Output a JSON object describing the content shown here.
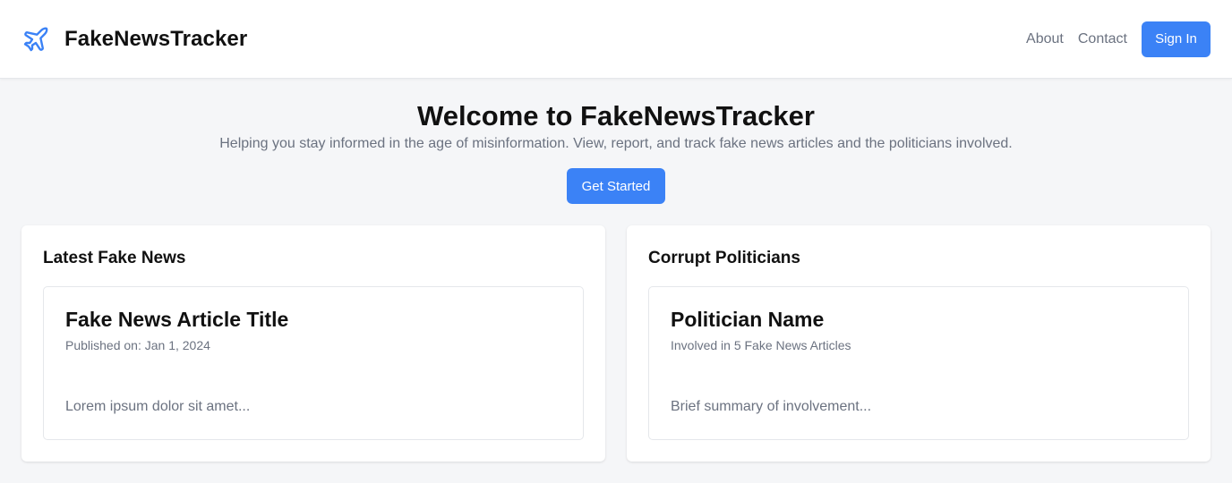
{
  "navbar": {
    "logo_icon": "airplane-icon",
    "brand": "FakeNewsTracker",
    "links": [
      "About",
      "Contact"
    ],
    "signin_label": "Sign In"
  },
  "hero": {
    "title": "Welcome to FakeNewsTracker",
    "subtitle": "Helping you stay informed in the age of misinformation. View, report, and track fake news articles and the politicians involved.",
    "cta_label": "Get Started"
  },
  "news": {
    "heading": "Latest Fake News",
    "article": {
      "title": "Fake News Article Title",
      "meta": "Published on: Jan 1, 2024",
      "excerpt": "Lorem ipsum dolor sit amet..."
    }
  },
  "politicians": {
    "heading": "Corrupt Politicians",
    "politician": {
      "name": "Politician Name",
      "meta": "Involved in 5 Fake News Articles",
      "summary": "Brief summary of involvement..."
    }
  },
  "colors": {
    "accent": "#3b82f6",
    "background": "#f5f6f8",
    "muted_text": "#6b7280"
  }
}
